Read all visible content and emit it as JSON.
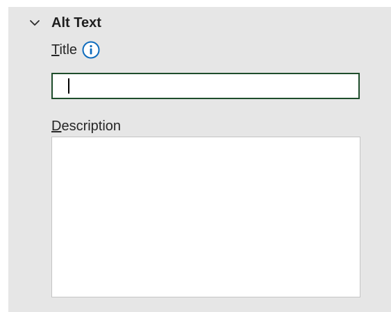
{
  "section": {
    "title": "Alt Text",
    "expanded": true,
    "chevron_icon": "chevron-down-icon"
  },
  "title_field": {
    "label_mnemonic": "T",
    "label_rest": "itle",
    "info_icon": "info-icon",
    "value": "",
    "focused": true
  },
  "description_field": {
    "label_mnemonic": "D",
    "label_rest": "escription",
    "value": ""
  },
  "colors": {
    "panel_bg": "#e6e6e6",
    "focus_border": "#1e4d2b",
    "info_blue": "#0f6cbd",
    "input_border": "#c4c4c4"
  }
}
